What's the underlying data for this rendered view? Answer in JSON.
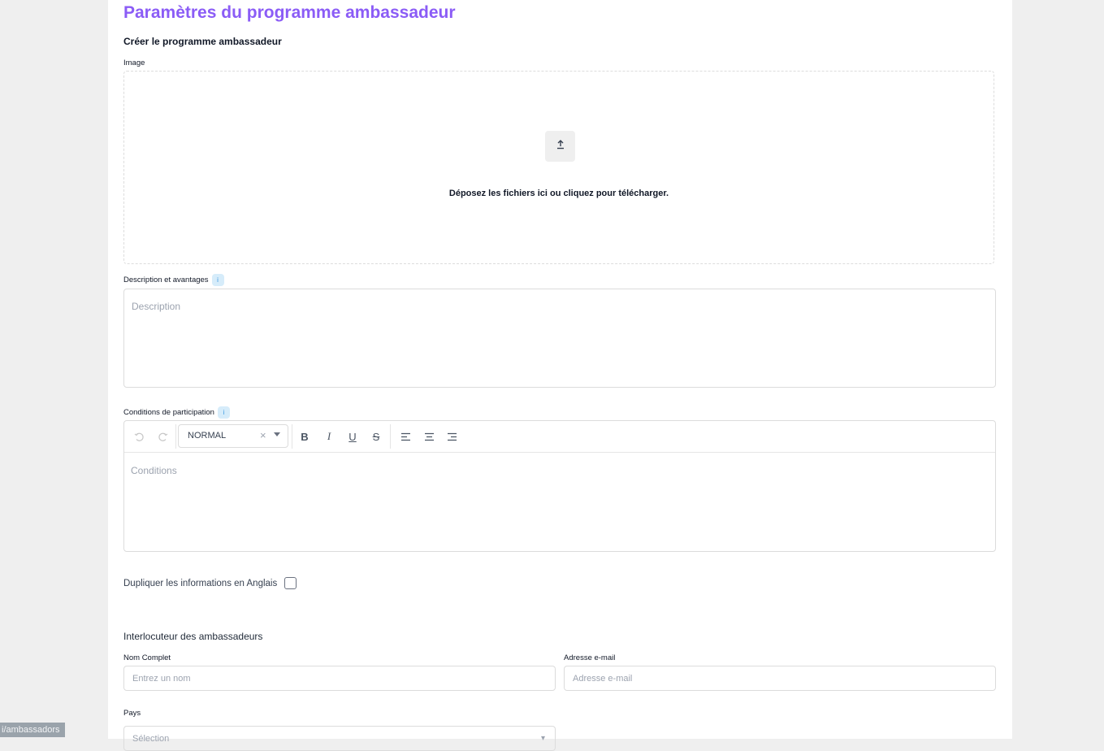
{
  "page": {
    "title": "Paramètres du programme ambassadeur",
    "subtitle": "Créer le programme ambassadeur"
  },
  "image_upload": {
    "label": "Image",
    "icon": "upload-icon",
    "text": "Déposez les fichiers ici ou cliquez pour télécharger."
  },
  "description": {
    "label": "Description et avantages",
    "info_icon": "i",
    "placeholder": "Description"
  },
  "conditions": {
    "label": "Conditions de participation",
    "info_icon": "i",
    "placeholder": "Conditions",
    "toolbar": {
      "undo_icon": "undo-icon",
      "redo_icon": "redo-icon",
      "style_value": "NORMAL",
      "clear_glyph": "×",
      "bold": "B",
      "italic": "I",
      "underline": "U",
      "strike": "S",
      "align_left_icon": "align-left-icon",
      "align_center_icon": "align-center-icon",
      "align_right_icon": "align-right-icon"
    }
  },
  "duplicate": {
    "label": "Dupliquer les informations en Anglais",
    "checked": false
  },
  "contact": {
    "section_title": "Interlocuteur des ambassadeurs",
    "name_label": "Nom Complet",
    "name_placeholder": "Entrez un nom",
    "email_label": "Adresse e-mail",
    "email_placeholder": "Adresse e-mail",
    "country_label": "Pays",
    "country_placeholder": "Sélection"
  },
  "status_bar": {
    "url": "i/ambassadors"
  },
  "colors": {
    "accent": "#8b5cf6",
    "info_badge_bg": "#d6ecfa",
    "border": "#dcdcdc",
    "page_bg": "#efefef"
  }
}
